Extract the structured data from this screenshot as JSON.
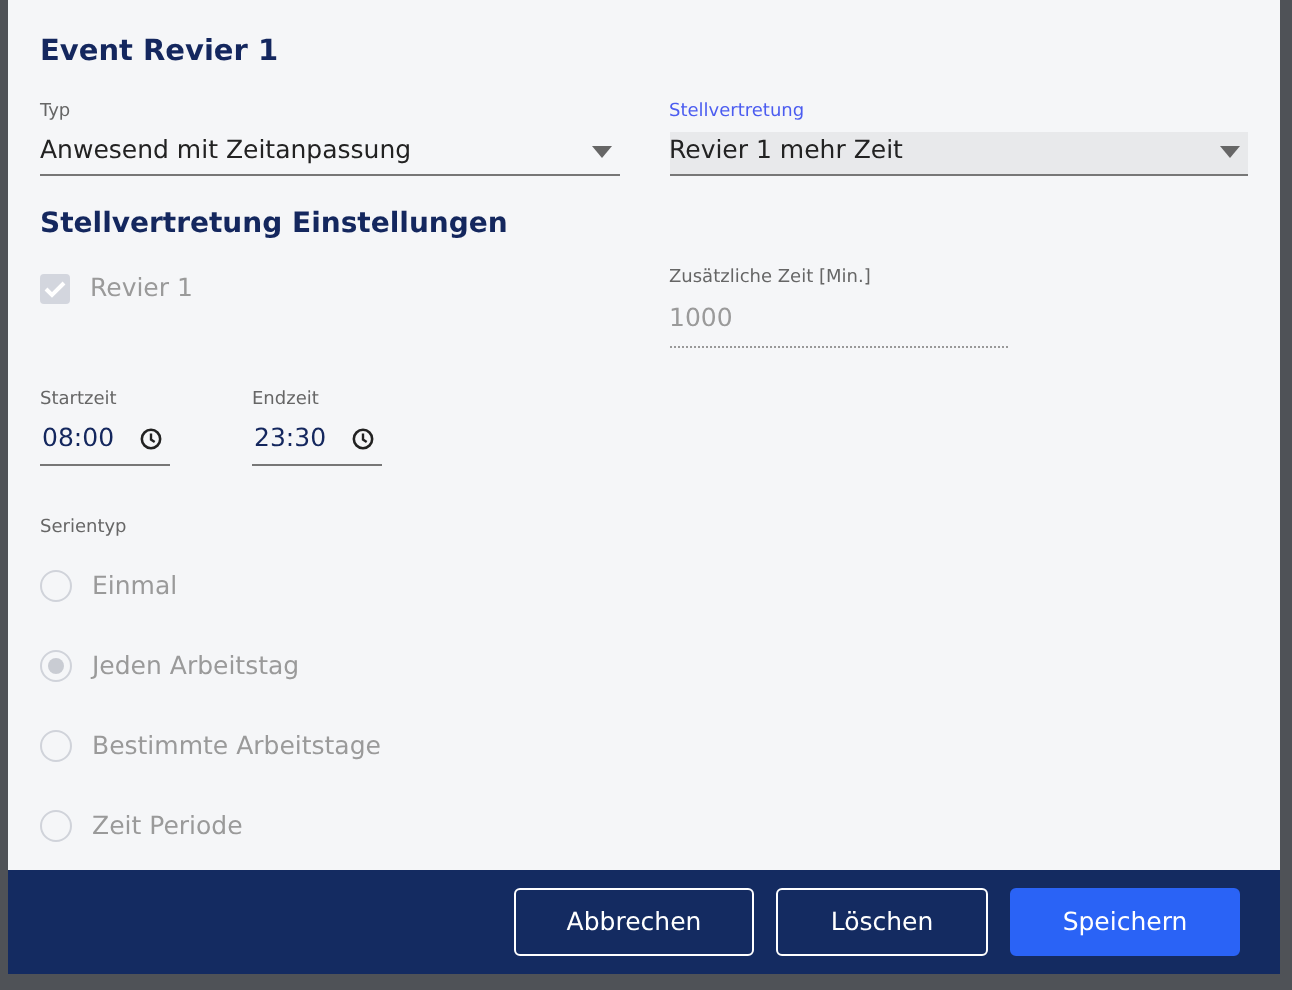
{
  "dialog": {
    "title": "Event Revier 1"
  },
  "selects": [
    {
      "label": "Typ",
      "value": "Anwesend mit Zeitanpassung",
      "focused": false
    },
    {
      "label": "Stellvertretung",
      "value": "Revier 1 mehr Zeit",
      "focused": true
    }
  ],
  "section_heading": "Stellvertretung Einstellungen",
  "checkbox": {
    "label": "Revier 1",
    "checked": true,
    "disabled": true
  },
  "extra_time": {
    "label": "Zusätzliche Zeit [Min.]",
    "value": "1000",
    "disabled": true
  },
  "times": [
    {
      "label": "Startzeit",
      "value": "08:00"
    },
    {
      "label": "Endzeit",
      "value": "23:30"
    }
  ],
  "series": {
    "label": "Serientyp",
    "options": [
      {
        "label": "Einmal",
        "selected": false,
        "disabled": true
      },
      {
        "label": "Jeden Arbeitstag",
        "selected": true,
        "disabled": true
      },
      {
        "label": "Bestimmte Arbeitstage",
        "selected": false,
        "disabled": true
      },
      {
        "label": "Zeit Periode",
        "selected": false,
        "disabled": true
      }
    ]
  },
  "buttons": [
    {
      "label": "Abbrechen",
      "kind": "outline"
    },
    {
      "label": "Löschen",
      "kind": "outline"
    },
    {
      "label": "Speichern",
      "kind": "primary"
    }
  ]
}
